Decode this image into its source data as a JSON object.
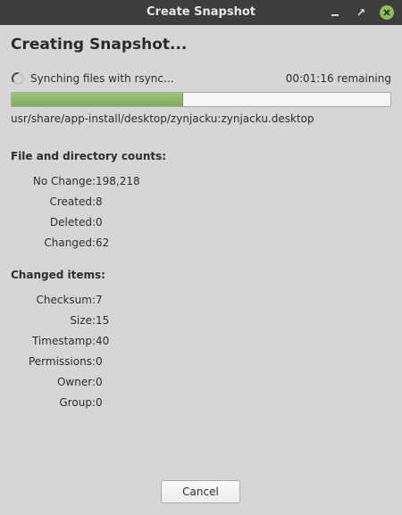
{
  "window": {
    "title": "Create Snapshot"
  },
  "heading": "Creating Snapshot...",
  "status": {
    "text": "Synching files with rsync...",
    "remaining": "00:01:16 remaining",
    "progress_fraction": 0.45,
    "current_file": "usr/share/app-install/desktop/zynjacku:zynjacku.desktop"
  },
  "file_counts": {
    "title": "File and directory counts:",
    "rows": [
      {
        "label": "No Change:",
        "value": "198,218"
      },
      {
        "label": "Created:",
        "value": "8"
      },
      {
        "label": "Deleted:",
        "value": "0"
      },
      {
        "label": "Changed:",
        "value": "62"
      }
    ]
  },
  "changed_items": {
    "title": "Changed items:",
    "rows": [
      {
        "label": "Checksum:",
        "value": "7"
      },
      {
        "label": "Size:",
        "value": "15"
      },
      {
        "label": "Timestamp:",
        "value": "40"
      },
      {
        "label": "Permissions:",
        "value": "0"
      },
      {
        "label": "Owner:",
        "value": "0"
      },
      {
        "label": "Group:",
        "value": "0"
      }
    ]
  },
  "buttons": {
    "cancel": "Cancel"
  },
  "colors": {
    "titlebar": "#3d3d3d",
    "window_bg": "#d6d6d6",
    "progress_fill": "#8bb566",
    "close_button": "#8fbf5a"
  }
}
